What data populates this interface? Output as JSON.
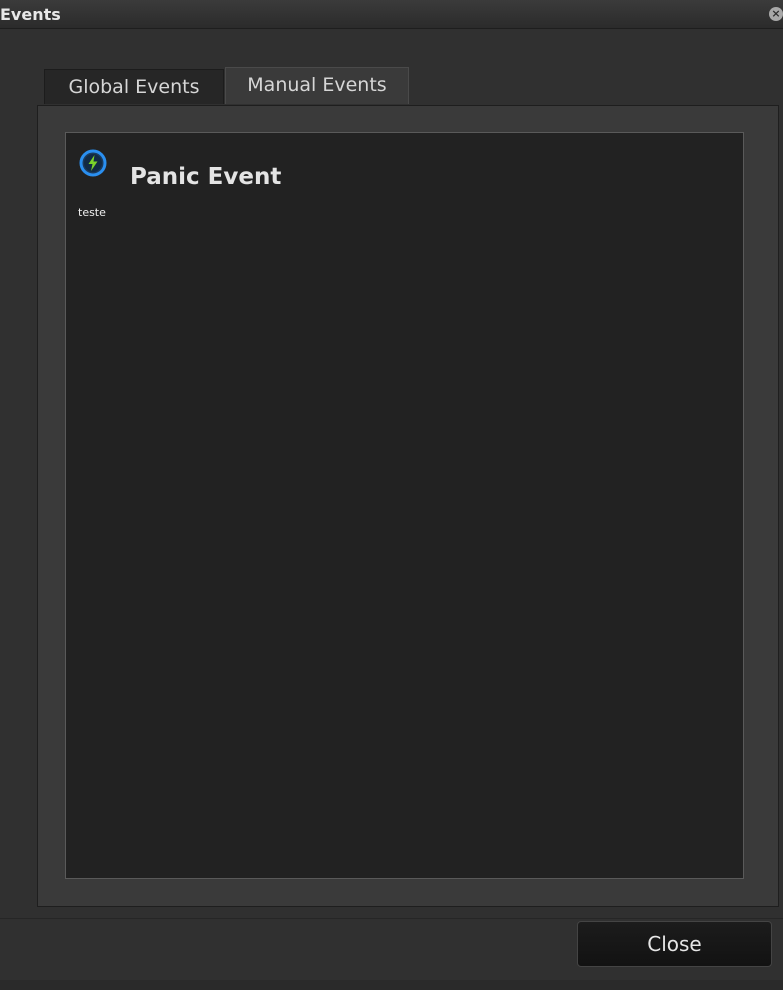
{
  "window": {
    "title": "Events"
  },
  "tabs": [
    {
      "label": "Global Events",
      "active": false
    },
    {
      "label": "Manual Events",
      "active": true
    }
  ],
  "events": [
    {
      "name": "Panic Event",
      "description": "teste",
      "icon": "lightning-circle-icon"
    }
  ],
  "footer": {
    "close_label": "Close"
  },
  "colors": {
    "background": "#303030",
    "list_background": "#222222",
    "icon_ring": "#2a8ff0",
    "icon_bolt": "#7ad32a"
  }
}
